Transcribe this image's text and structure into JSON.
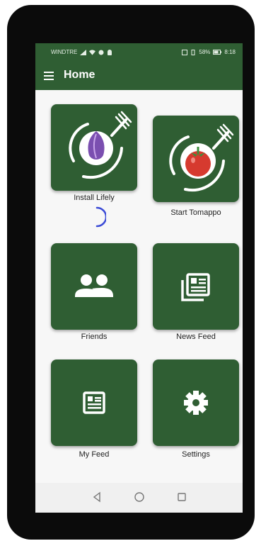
{
  "status_bar": {
    "carrier": "WINDTRE",
    "battery": "58%",
    "time": "8:18"
  },
  "app_bar": {
    "title": "Home"
  },
  "tiles": [
    {
      "label": "Install Lifely",
      "icon": "lifely-plate-fork-icon"
    },
    {
      "label": "Start Tomappo",
      "icon": "tomato-plate-fork-icon"
    },
    {
      "label": "Friends",
      "icon": "people-icon"
    },
    {
      "label": "News Feed",
      "icon": "news-feed-icon"
    },
    {
      "label": "My Feed",
      "icon": "article-icon"
    },
    {
      "label": "Settings",
      "icon": "gear-icon"
    }
  ],
  "colors": {
    "primary": "#2f5e33",
    "spinner": "#3b4bd6",
    "background": "#f7f7f7"
  }
}
